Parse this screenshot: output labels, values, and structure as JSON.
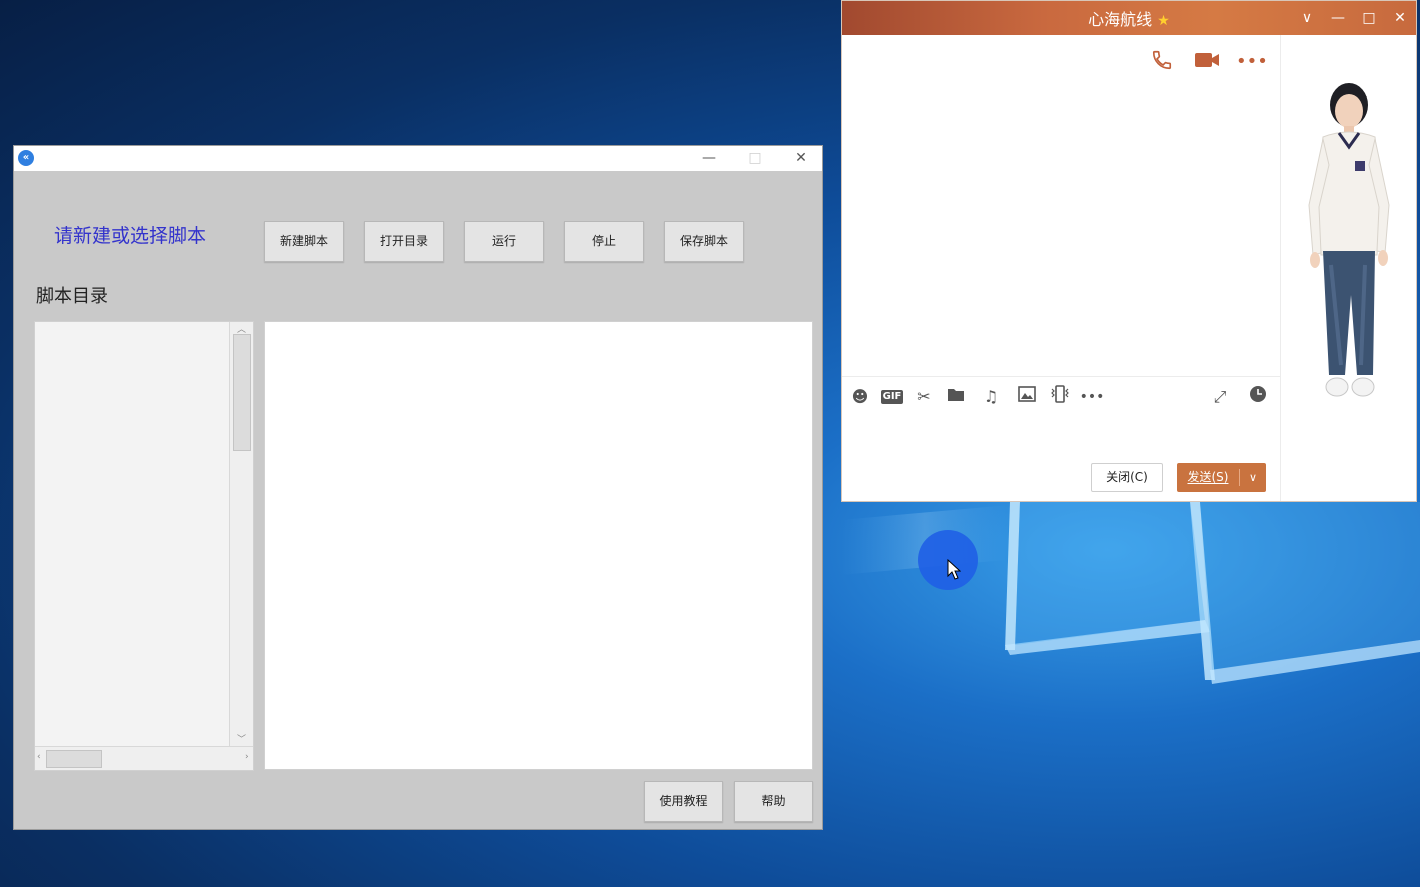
{
  "colors": {
    "app_status_text": "#3333cc",
    "chat_titlebar": "#c9693f",
    "send_button": "#c9733f",
    "call_icons": "#c1603a",
    "cursor_highlight": "#1f5fe6"
  },
  "script_app": {
    "status_text": "请新建或选择脚本",
    "toolbar": {
      "new_script": "新建脚本",
      "open_dir": "打开目录",
      "run": "运行",
      "stop": "停止",
      "save_script": "保存脚本"
    },
    "directory_label": "脚本目录",
    "footer": {
      "tutorial": "使用教程",
      "help": "帮助"
    },
    "icons": {
      "logo": "app-logo-icon",
      "minimize": "minimize-icon",
      "maximize": "maximize-icon",
      "close": "close-icon"
    }
  },
  "chat": {
    "contact_name": "心海航线",
    "star": "★",
    "close_button": "关闭(C)",
    "send_button": "发送(S)",
    "send_dropdown": "∨",
    "gif_label": "GIF",
    "icons": {
      "voice_call": "phone-icon",
      "video_call": "video-icon",
      "more": "more-icon",
      "emoji": "emoji-icon",
      "gif": "gif-icon",
      "screenshot": "scissors-icon",
      "file": "folder-icon",
      "music": "music-icon",
      "image": "image-icon",
      "shake": "shake-icon",
      "more_tools": "more-icon",
      "expand": "expand-icon",
      "history": "clock-icon"
    }
  }
}
